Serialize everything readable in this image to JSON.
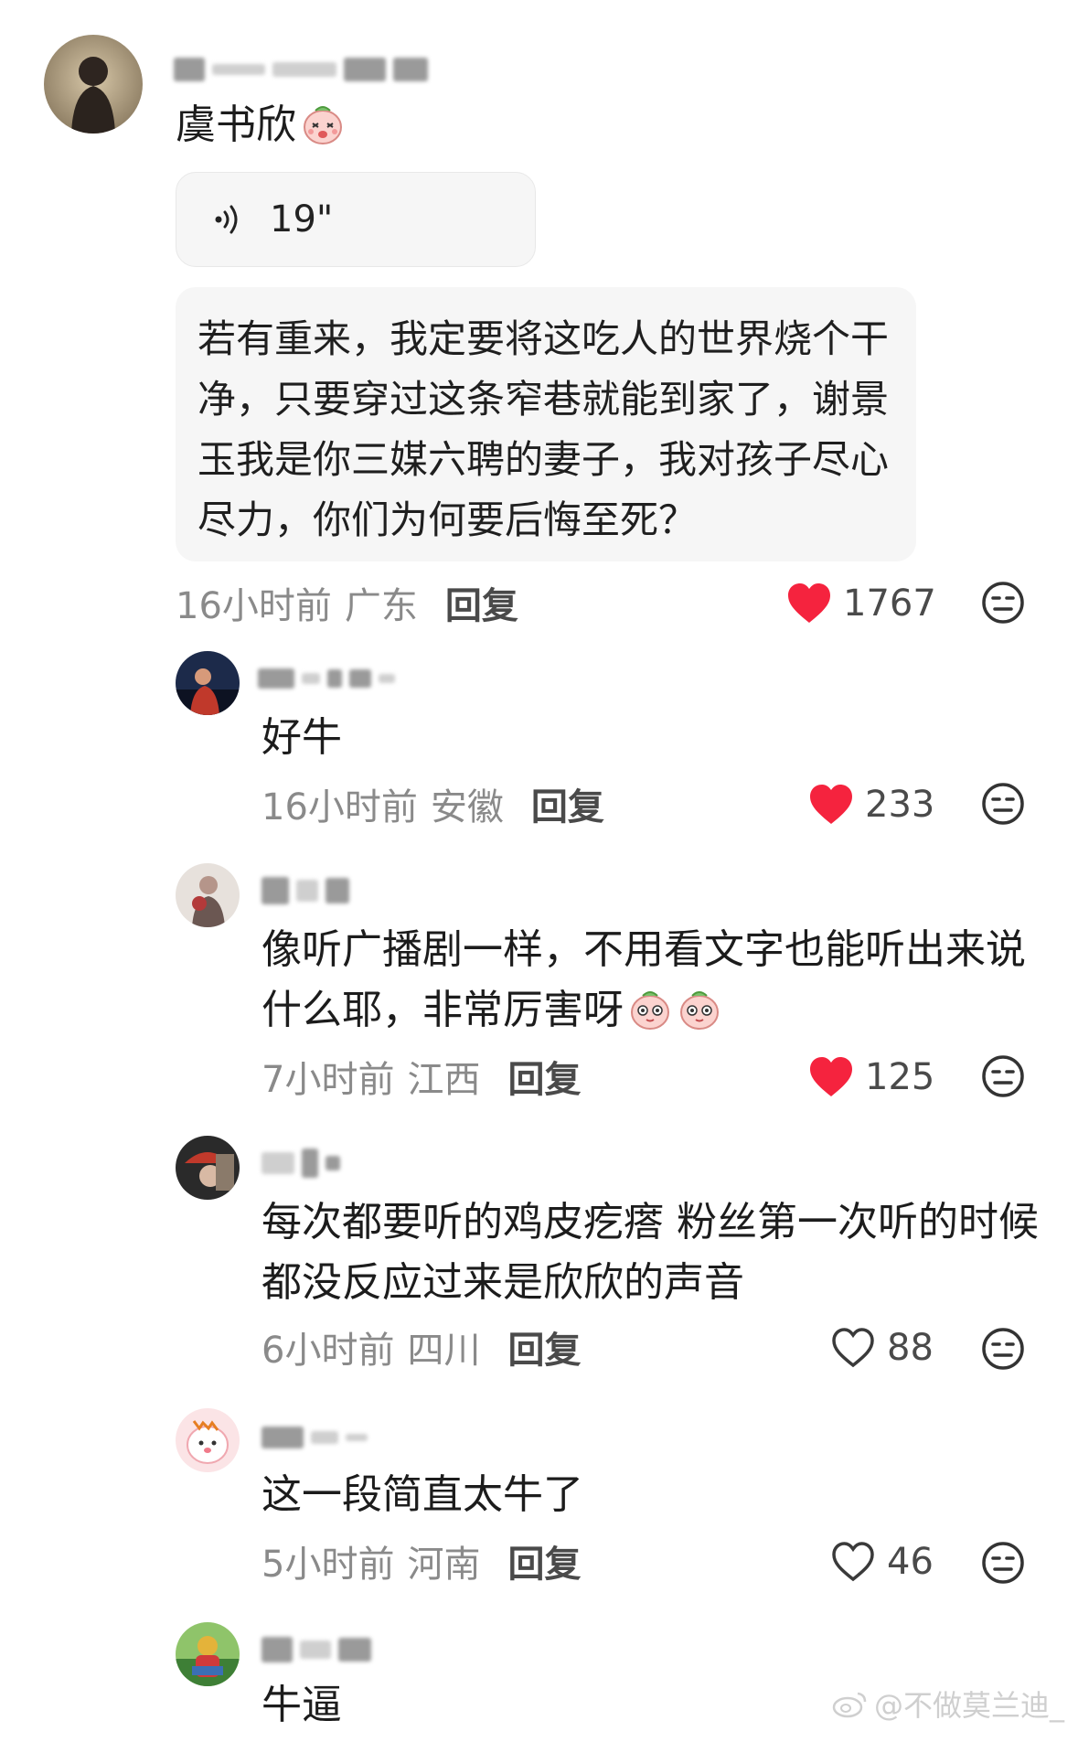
{
  "comments": [
    {
      "text": "虞书欣",
      "voice_duration": "19\"",
      "quote_lines": [
        "若有重来，我定要将这吃人的世界烧个干",
        "净，只要穿过这条窄巷就能到家了，谢景",
        "玉我是你三媒六聘的妻子，我对孩子尽心",
        "尽力，你们为何要后悔至死？"
      ],
      "time": "16小时前",
      "location": "广东",
      "reply": "回复",
      "likes": "1767",
      "liked": true
    },
    {
      "text": "好牛",
      "time": "16小时前",
      "location": "安徽",
      "reply": "回复",
      "likes": "233",
      "liked": true
    },
    {
      "text_lines": [
        "像听广播剧一样，不用看文字也能听出来说",
        "什么耶，非常厉害呀"
      ],
      "time": "7小时前",
      "location": "江西",
      "reply": "回复",
      "likes": "125",
      "liked": true
    },
    {
      "text_lines": [
        "每次都要听的鸡皮疙瘩 粉丝第一次听的时候",
        "都没反应过来是欣欣的声音"
      ],
      "time": "6小时前",
      "location": "四川",
      "reply": "回复",
      "likes": "88",
      "liked": false
    },
    {
      "text": "这一段简直太牛了",
      "time": "5小时前",
      "location": "河南",
      "reply": "回复",
      "likes": "46",
      "liked": false
    },
    {
      "text": "牛逼"
    }
  ],
  "watermark": "@不做莫兰迪_",
  "colors": {
    "heart_liked": "#f5233e",
    "heart_outline": "#7a7a7a",
    "meta_text": "#8a8a8a",
    "bubble_bg": "#f6f6f6"
  },
  "icons": [
    "voice-icon",
    "heart-icon",
    "dislike-face-icon",
    "shy-emoji-icon",
    "cute-face-emoji-icon",
    "weibo-icon"
  ]
}
